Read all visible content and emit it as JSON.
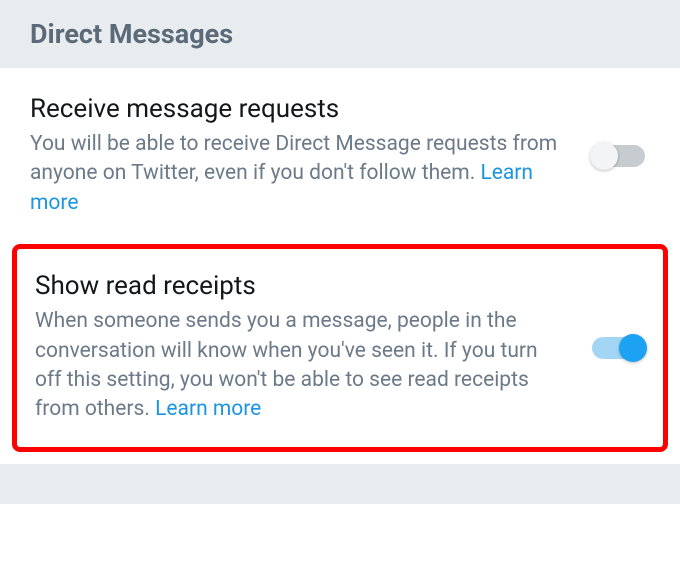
{
  "header": {
    "title": "Direct Messages"
  },
  "settings": {
    "receive_requests": {
      "title": "Receive message requests",
      "description": "You will be able to receive Direct Message requests from anyone on Twitter, even if you don't follow them. ",
      "learn_more": "Learn more",
      "enabled": false
    },
    "read_receipts": {
      "title": "Show read receipts",
      "description": "When someone sends you a message, people in the conversation will know when you've seen it. If you turn off this setting, you won't be able to see read receipts from others. ",
      "learn_more": "Learn more",
      "enabled": true
    }
  },
  "colors": {
    "accent": "#1da1f2",
    "highlight_border": "#ff0000",
    "header_bg": "#e8ecef",
    "text_primary": "#14171a",
    "text_secondary": "#6b7a88"
  }
}
